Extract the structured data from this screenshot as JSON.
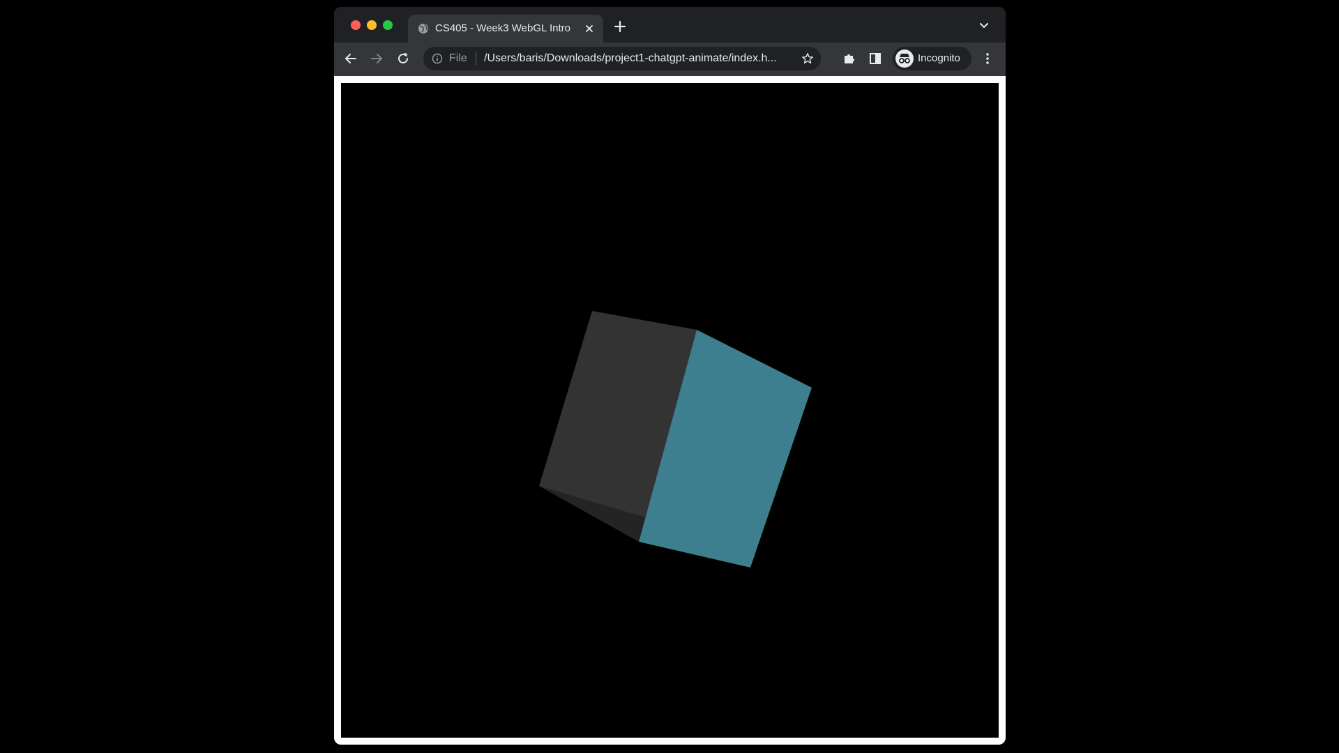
{
  "window": {
    "controls": [
      "close",
      "minimize",
      "maximize"
    ]
  },
  "tab": {
    "title": "CS405 - Week3 WebGL Intro",
    "favicon": "globe-icon",
    "close_icon": "close-icon"
  },
  "toolbar": {
    "back_icon": "arrow-back-icon",
    "forward_icon": "arrow-forward-icon",
    "reload_icon": "reload-icon",
    "omnibox": {
      "info_icon": "info-icon",
      "scheme": "File",
      "url": "/Users/baris/Downloads/project1-chatgpt-animate/index.h...",
      "bookmark_icon": "star-icon"
    },
    "extensions_icon": "puzzle-icon",
    "sidepanel_icon": "side-panel-icon",
    "profile": {
      "icon": "incognito-icon",
      "label": "Incognito"
    },
    "menu_icon": "kebab-menu-icon"
  },
  "page": {
    "canvas": {
      "scene": "rotating cube",
      "face_colors": {
        "dark_face": "#333333",
        "teal_face": "#3d7f8e",
        "shadow_edge": "#242424"
      }
    }
  }
}
